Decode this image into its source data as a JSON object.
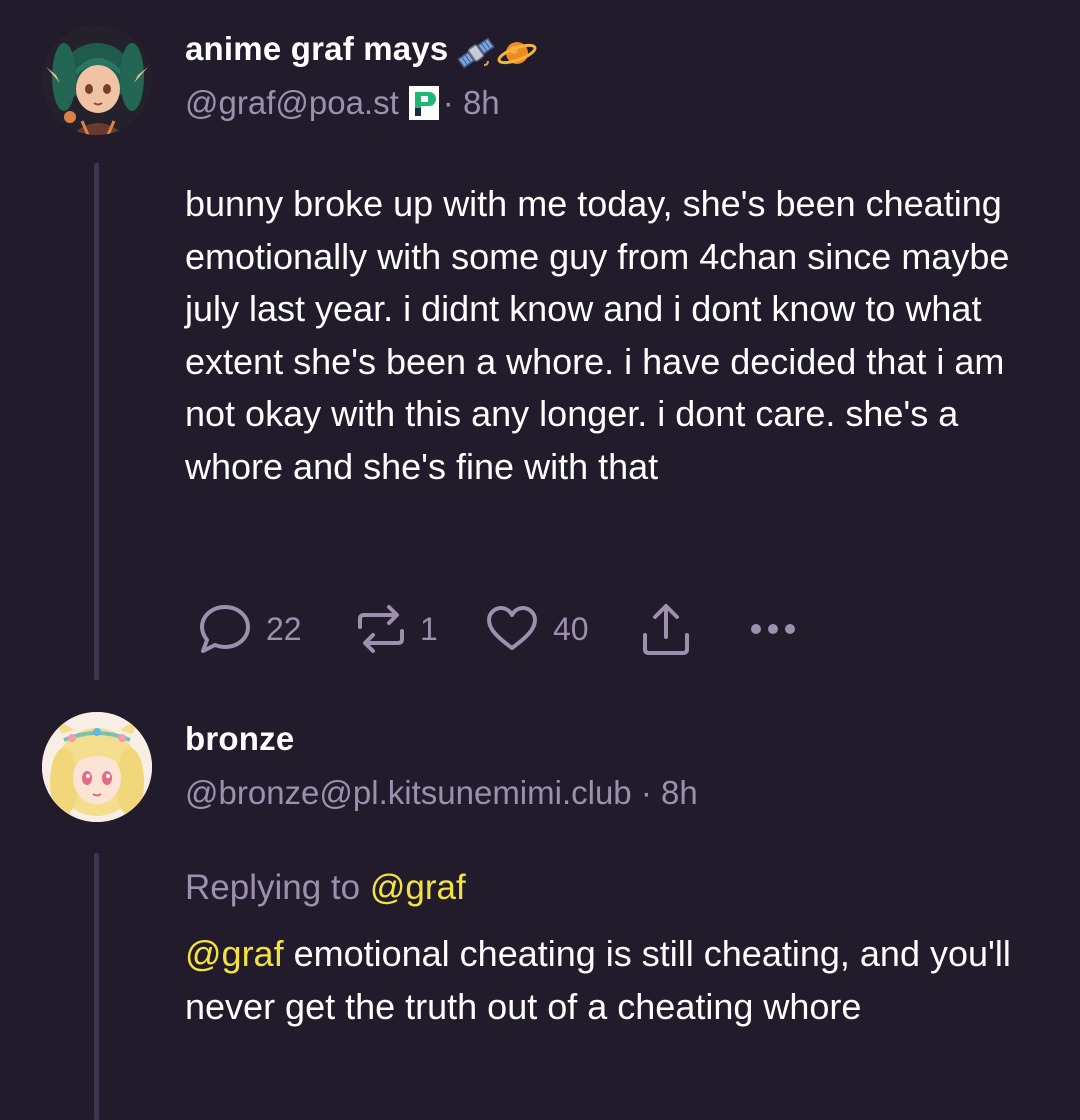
{
  "posts": [
    {
      "display_name": "anime graf mays",
      "name_emojis": [
        "satellite-emoji",
        "ringed-planet-emoji"
      ],
      "handle": "@graf@poa.st",
      "instance_badge_icon": "pleroma-p-icon",
      "separator": "·",
      "time": "8h",
      "avatar_icon": "anime-elf-avatar",
      "content": "bunny broke up with me today, she's been cheating emotionally with some guy from 4chan since maybe july last year. i didnt know and i dont know to what extent she's been a whore. i have decided that i am not okay with this any longer. i dont care. she's a whore and she's fine with that",
      "actions": {
        "reply": {
          "icon": "speech-bubble-icon",
          "count": "22"
        },
        "boost": {
          "icon": "repeat-icon",
          "count": "1"
        },
        "like": {
          "icon": "heart-icon",
          "count": "40"
        },
        "share": {
          "icon": "share-upload-icon"
        },
        "more": {
          "icon": "ellipsis-icon"
        }
      }
    },
    {
      "display_name": "bronze",
      "handle": "@bronze@pl.kitsunemimi.club",
      "separator": "·",
      "time": "8h",
      "avatar_icon": "anime-blonde-avatar",
      "replying_prefix": "Replying to",
      "replying_mention": "@graf",
      "content_mention": "@graf",
      "content": " emotional cheating is still cheating, and you'll never get the truth out of a cheating whore"
    }
  ],
  "colors": {
    "background": "#211b2c",
    "muted_text": "#9b90ad",
    "mention": "#f5e33d",
    "thread_line": "#3e3650"
  }
}
